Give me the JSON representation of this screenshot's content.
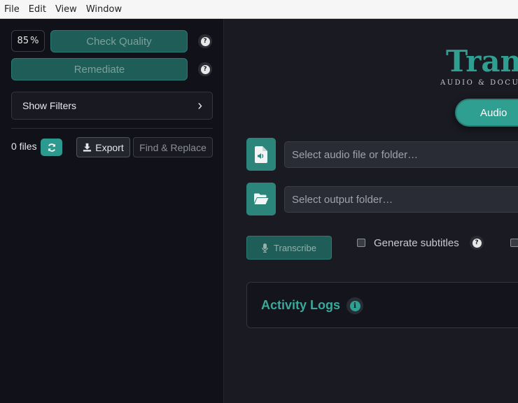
{
  "menubar": {
    "items": [
      "File",
      "Edit",
      "View",
      "Window"
    ]
  },
  "sidebar": {
    "quality_value": "85",
    "quality_unit": "%",
    "check_quality_label": "Check Quality",
    "remediate_label": "Remediate",
    "show_filters_label": "Show Filters",
    "show_filters_chevron": "›",
    "file_count": "0 files",
    "export_label": "Export",
    "find_replace_label": "Find & Replace"
  },
  "main": {
    "title": "Trans",
    "subtitle": "AUDIO & DOCUM",
    "mode_label": "Audio",
    "audio_input": {
      "placeholder": "Select audio file or folder…"
    },
    "output_input": {
      "placeholder": "Select output folder…"
    },
    "transcribe_label": "Transcribe",
    "generate_subtitles_label": "Generate subtitles",
    "activity_logs_title": "Activity Logs"
  },
  "icons": {
    "help": "question-circle-icon",
    "refresh": "refresh-icon",
    "download": "download-icon",
    "audio_file": "audio-file-icon",
    "folder": "folder-open-icon",
    "microphone": "microphone-icon",
    "info": "info-icon"
  },
  "colors": {
    "accent": "#2f9f91",
    "accent_dark": "#1f5e58",
    "background": "#191a22",
    "sidebar_bg": "#111219"
  }
}
